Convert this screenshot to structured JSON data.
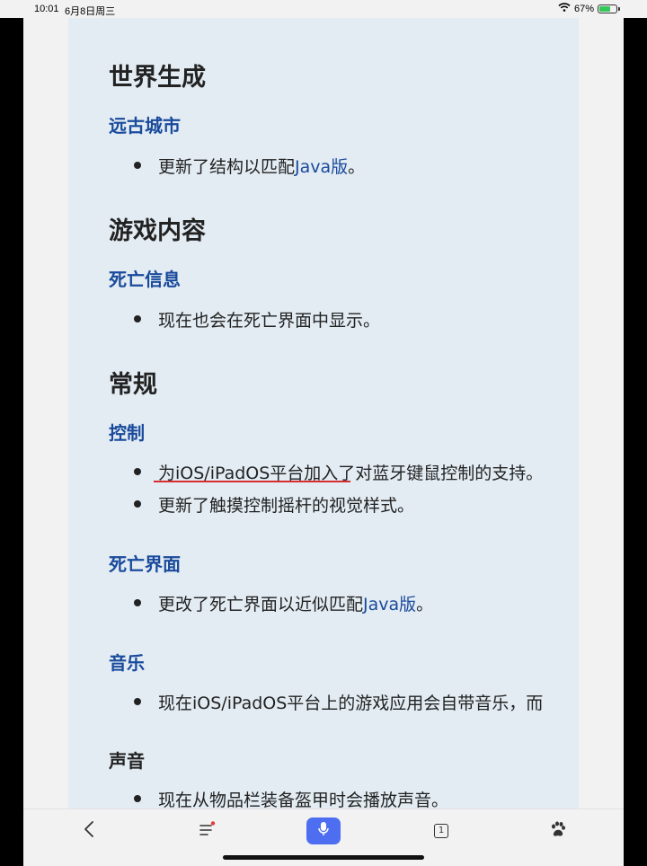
{
  "status": {
    "time": "10:01",
    "date": "6月8日周三",
    "battery": "67%",
    "battery_level": 0.67
  },
  "article": {
    "sections": [
      {
        "title": "世界生成"
      },
      {
        "title": "游戏内容"
      },
      {
        "title": "常规"
      }
    ],
    "world": {
      "sub": "远古城市",
      "item_pre": "更新了结构以匹配",
      "item_link": "Java版",
      "item_post": "。"
    },
    "content": {
      "sub": "死亡信息",
      "item": "现在也会在死亡界面中显示。"
    },
    "general": {
      "control_sub": "控制",
      "control_item1": "为iOS/iPadOS平台加入了对蓝牙键鼠控制的支持。",
      "control_item2": "更新了触摸控制摇杆的视觉样式。",
      "death_screen_sub": "死亡界面",
      "death_item_pre": "更改了死亡界面以近似匹配",
      "death_item_link": "Java版",
      "death_item_post": "。",
      "music_sub": "音乐",
      "music_item": "现在iOS/iPadOS平台上的游戏应用会自带音乐，而",
      "sound_sub": "声音",
      "sound_item": "现在从物品栏装备盔甲时会播放声音。"
    }
  },
  "toolbar": {
    "back_icon": "chevron-left-icon",
    "menu_icon": "menu-icon",
    "voice_icon": "microphone-icon",
    "tabs_count": "1",
    "baidu_icon": "paw-icon"
  },
  "colors": {
    "link": "#1a4a9c",
    "content_bg": "#e3ecf3",
    "mic_button": "#4e6ef2",
    "annotation_underline": "#d62d2d"
  }
}
